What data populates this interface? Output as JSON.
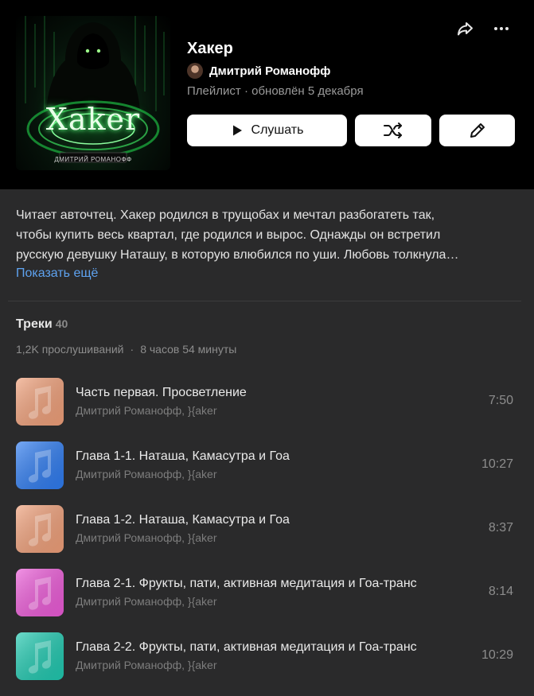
{
  "playlist": {
    "title": "Хакер",
    "cover_text": "Хaker",
    "cover_subtitle": "ДМИТРИЙ РОМАНОФФ",
    "author": "Дмитрий Романофф",
    "type_label": "Плейлист",
    "updated": "обновлён 5 декабря"
  },
  "actions": {
    "play_label": "Слушать",
    "shuffle_icon": "shuffle-icon",
    "edit_icon": "pencil-icon",
    "share_icon": "share-icon",
    "more_icon": "more-icon"
  },
  "description": {
    "lines": [
      "Читает авточтец. Хакер родился в трущобах и мечтал разбогатеть так,",
      "чтобы купить весь квартал, где родился и вырос. Однажды он встретил",
      "русскую девушку Наташу, в которую влюбился по уши. Любовь толкнула…"
    ],
    "show_more": "Показать ещё"
  },
  "tracks_section": {
    "heading": "Треки",
    "count": "40",
    "plays": "1,2K прослушиваний",
    "separator": "·",
    "duration": "8 часов 54 минуты"
  },
  "tracks": [
    {
      "title": "Часть первая. Просветление",
      "artist": "Дмитрий Романофф, }{aker",
      "duration": "7:50",
      "color": "#f0a07a"
    },
    {
      "title": "Глава 1-1. Наташа, Камасутра и Гоа",
      "artist": "Дмитрий Романофф, }{aker",
      "duration": "10:27",
      "color": "#2f7cf0"
    },
    {
      "title": "Глава 1-2. Наташа, Камасутра и Гоа",
      "artist": "Дмитрий Романофф, }{aker",
      "duration": "8:37",
      "color": "#f0a07a"
    },
    {
      "title": "Глава 2-1. Фрукты, пати, активная медитация и Гоа-транс",
      "artist": "Дмитрий Романофф, }{aker",
      "duration": "8:14",
      "color": "#ec5bd8"
    },
    {
      "title": "Глава 2-2. Фрукты, пати, активная медитация и Гоа-транс",
      "artist": "Дмитрий Романофф, }{aker",
      "duration": "10:29",
      "color": "#20c9b0"
    }
  ],
  "colors": {
    "header_bg": "#000000",
    "page_bg": "#2a2a2b",
    "link": "#5ea2ef",
    "button_bg": "#ffffff"
  }
}
